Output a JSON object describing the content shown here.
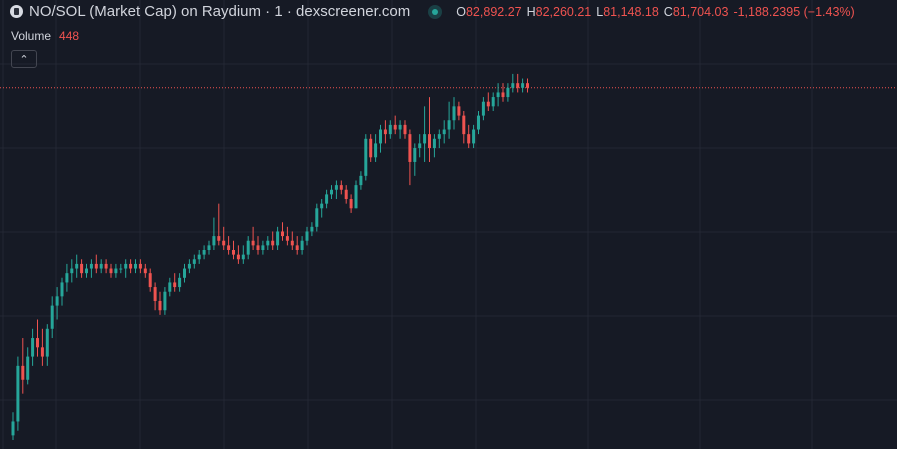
{
  "header": {
    "title": "NO/SOL (Market Cap) on Raydium · 1 · dexscreener.com",
    "ohlc": {
      "o_label": "O",
      "o": "82,892.27",
      "h_label": "H",
      "h": "82,260.21",
      "l_label": "L",
      "l": "81,148.18",
      "c_label": "C",
      "c": "81,704.03",
      "change": "-1,188.2395 (−1.43%)"
    }
  },
  "volume": {
    "label": "Volume",
    "value": "448"
  },
  "colors": {
    "background": "#161a25",
    "grid": "#232733",
    "up": "#26a69a",
    "down": "#ef5350",
    "price_line": "#ef5350"
  },
  "chart_data": {
    "type": "candlestick",
    "ylim": [
      20,
      102
    ],
    "grid": true,
    "last_price_line": 96,
    "candles": [
      {
        "o": 21,
        "h": 26,
        "l": 20,
        "c": 24
      },
      {
        "o": 24,
        "h": 38,
        "l": 22,
        "c": 36
      },
      {
        "o": 36,
        "h": 42,
        "l": 30,
        "c": 33
      },
      {
        "o": 33,
        "h": 40,
        "l": 32,
        "c": 38
      },
      {
        "o": 38,
        "h": 44,
        "l": 36,
        "c": 42
      },
      {
        "o": 42,
        "h": 46,
        "l": 38,
        "c": 40
      },
      {
        "o": 40,
        "h": 44,
        "l": 36,
        "c": 38
      },
      {
        "o": 38,
        "h": 45,
        "l": 36,
        "c": 44
      },
      {
        "o": 44,
        "h": 51,
        "l": 42,
        "c": 49
      },
      {
        "o": 49,
        "h": 53,
        "l": 46,
        "c": 51
      },
      {
        "o": 51,
        "h": 55,
        "l": 49,
        "c": 54
      },
      {
        "o": 54,
        "h": 58,
        "l": 52,
        "c": 56
      },
      {
        "o": 56,
        "h": 59,
        "l": 54,
        "c": 57
      },
      {
        "o": 57,
        "h": 60,
        "l": 55,
        "c": 58
      },
      {
        "o": 58,
        "h": 59,
        "l": 55,
        "c": 56
      },
      {
        "o": 56,
        "h": 58,
        "l": 55,
        "c": 57
      },
      {
        "o": 57,
        "h": 59,
        "l": 55,
        "c": 58
      },
      {
        "o": 58,
        "h": 60,
        "l": 56,
        "c": 57
      },
      {
        "o": 57,
        "h": 59,
        "l": 56,
        "c": 58
      },
      {
        "o": 58,
        "h": 59,
        "l": 56,
        "c": 57
      },
      {
        "o": 57,
        "h": 58,
        "l": 55,
        "c": 56
      },
      {
        "o": 56,
        "h": 58,
        "l": 55,
        "c": 57
      },
      {
        "o": 57,
        "h": 58,
        "l": 56,
        "c": 57
      },
      {
        "o": 57,
        "h": 59,
        "l": 55,
        "c": 58
      },
      {
        "o": 58,
        "h": 59,
        "l": 56,
        "c": 57
      },
      {
        "o": 57,
        "h": 59,
        "l": 56,
        "c": 58
      },
      {
        "o": 58,
        "h": 59,
        "l": 56,
        "c": 57
      },
      {
        "o": 57,
        "h": 58,
        "l": 55,
        "c": 56
      },
      {
        "o": 56,
        "h": 57,
        "l": 52,
        "c": 53
      },
      {
        "o": 53,
        "h": 54,
        "l": 48,
        "c": 50
      },
      {
        "o": 50,
        "h": 52,
        "l": 47,
        "c": 48
      },
      {
        "o": 48,
        "h": 53,
        "l": 47,
        "c": 52
      },
      {
        "o": 52,
        "h": 55,
        "l": 51,
        "c": 54
      },
      {
        "o": 54,
        "h": 56,
        "l": 52,
        "c": 53
      },
      {
        "o": 53,
        "h": 56,
        "l": 52,
        "c": 55
      },
      {
        "o": 55,
        "h": 58,
        "l": 54,
        "c": 57
      },
      {
        "o": 57,
        "h": 59,
        "l": 56,
        "c": 58
      },
      {
        "o": 58,
        "h": 60,
        "l": 57,
        "c": 59
      },
      {
        "o": 59,
        "h": 61,
        "l": 58,
        "c": 60
      },
      {
        "o": 60,
        "h": 62,
        "l": 59,
        "c": 61
      },
      {
        "o": 61,
        "h": 63,
        "l": 60,
        "c": 62
      },
      {
        "o": 62,
        "h": 68,
        "l": 61,
        "c": 64
      },
      {
        "o": 64,
        "h": 71,
        "l": 62,
        "c": 63
      },
      {
        "o": 63,
        "h": 66,
        "l": 61,
        "c": 62
      },
      {
        "o": 62,
        "h": 64,
        "l": 60,
        "c": 61
      },
      {
        "o": 61,
        "h": 63,
        "l": 59,
        "c": 60
      },
      {
        "o": 60,
        "h": 62,
        "l": 58,
        "c": 59
      },
      {
        "o": 59,
        "h": 62,
        "l": 58,
        "c": 60
      },
      {
        "o": 60,
        "h": 64,
        "l": 59,
        "c": 63
      },
      {
        "o": 63,
        "h": 66,
        "l": 61,
        "c": 62
      },
      {
        "o": 62,
        "h": 64,
        "l": 60,
        "c": 61
      },
      {
        "o": 61,
        "h": 63,
        "l": 60,
        "c": 62
      },
      {
        "o": 62,
        "h": 64,
        "l": 61,
        "c": 63
      },
      {
        "o": 63,
        "h": 65,
        "l": 61,
        "c": 62
      },
      {
        "o": 62,
        "h": 66,
        "l": 61,
        "c": 65
      },
      {
        "o": 65,
        "h": 67,
        "l": 63,
        "c": 64
      },
      {
        "o": 64,
        "h": 66,
        "l": 62,
        "c": 63
      },
      {
        "o": 63,
        "h": 65,
        "l": 61,
        "c": 62
      },
      {
        "o": 62,
        "h": 64,
        "l": 60,
        "c": 61
      },
      {
        "o": 61,
        "h": 64,
        "l": 60,
        "c": 63
      },
      {
        "o": 63,
        "h": 66,
        "l": 62,
        "c": 65
      },
      {
        "o": 65,
        "h": 67,
        "l": 64,
        "c": 66
      },
      {
        "o": 66,
        "h": 71,
        "l": 65,
        "c": 70
      },
      {
        "o": 70,
        "h": 72,
        "l": 68,
        "c": 71
      },
      {
        "o": 71,
        "h": 74,
        "l": 70,
        "c": 73
      },
      {
        "o": 73,
        "h": 75,
        "l": 72,
        "c": 74
      },
      {
        "o": 74,
        "h": 76,
        "l": 72,
        "c": 75
      },
      {
        "o": 75,
        "h": 76,
        "l": 73,
        "c": 74
      },
      {
        "o": 74,
        "h": 75,
        "l": 71,
        "c": 72
      },
      {
        "o": 72,
        "h": 73,
        "l": 69,
        "c": 70
      },
      {
        "o": 70,
        "h": 76,
        "l": 70,
        "c": 75
      },
      {
        "o": 75,
        "h": 78,
        "l": 74,
        "c": 77
      },
      {
        "o": 77,
        "h": 86,
        "l": 76,
        "c": 85
      },
      {
        "o": 85,
        "h": 86,
        "l": 80,
        "c": 81
      },
      {
        "o": 81,
        "h": 86,
        "l": 80,
        "c": 84
      },
      {
        "o": 84,
        "h": 88,
        "l": 82,
        "c": 87
      },
      {
        "o": 87,
        "h": 89,
        "l": 84,
        "c": 86
      },
      {
        "o": 86,
        "h": 89,
        "l": 85,
        "c": 88
      },
      {
        "o": 88,
        "h": 90,
        "l": 86,
        "c": 87
      },
      {
        "o": 87,
        "h": 89,
        "l": 85,
        "c": 88
      },
      {
        "o": 88,
        "h": 89,
        "l": 85,
        "c": 86
      },
      {
        "o": 86,
        "h": 87,
        "l": 75,
        "c": 80
      },
      {
        "o": 80,
        "h": 84,
        "l": 77,
        "c": 83
      },
      {
        "o": 83,
        "h": 86,
        "l": 81,
        "c": 84
      },
      {
        "o": 84,
        "h": 92,
        "l": 80,
        "c": 86
      },
      {
        "o": 86,
        "h": 94,
        "l": 80,
        "c": 83
      },
      {
        "o": 83,
        "h": 86,
        "l": 81,
        "c": 85
      },
      {
        "o": 85,
        "h": 87,
        "l": 83,
        "c": 86
      },
      {
        "o": 86,
        "h": 89,
        "l": 84,
        "c": 87
      },
      {
        "o": 87,
        "h": 93,
        "l": 85,
        "c": 89
      },
      {
        "o": 89,
        "h": 94,
        "l": 87,
        "c": 92
      },
      {
        "o": 92,
        "h": 93,
        "l": 89,
        "c": 90
      },
      {
        "o": 90,
        "h": 91,
        "l": 84,
        "c": 86
      },
      {
        "o": 86,
        "h": 88,
        "l": 83,
        "c": 84
      },
      {
        "o": 84,
        "h": 88,
        "l": 83,
        "c": 87
      },
      {
        "o": 87,
        "h": 91,
        "l": 86,
        "c": 90
      },
      {
        "o": 90,
        "h": 94,
        "l": 89,
        "c": 93
      },
      {
        "o": 93,
        "h": 95,
        "l": 91,
        "c": 92
      },
      {
        "o": 92,
        "h": 95,
        "l": 91,
        "c": 94
      },
      {
        "o": 94,
        "h": 97,
        "l": 92,
        "c": 95
      },
      {
        "o": 95,
        "h": 97,
        "l": 93,
        "c": 94
      },
      {
        "o": 94,
        "h": 97,
        "l": 93,
        "c": 96
      },
      {
        "o": 96,
        "h": 99,
        "l": 95,
        "c": 97
      },
      {
        "o": 97,
        "h": 99,
        "l": 95,
        "c": 96
      },
      {
        "o": 96,
        "h": 98,
        "l": 95,
        "c": 97
      },
      {
        "o": 97,
        "h": 98,
        "l": 95,
        "c": 96
      }
    ]
  }
}
